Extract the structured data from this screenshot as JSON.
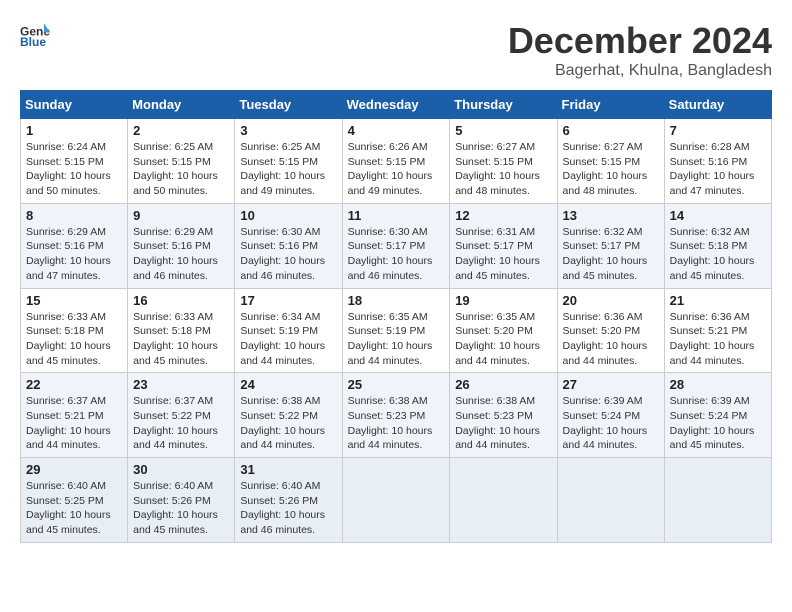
{
  "logo": {
    "line1": "General",
    "line2": "Blue"
  },
  "title": "December 2024",
  "location": "Bagerhat, Khulna, Bangladesh",
  "days_of_week": [
    "Sunday",
    "Monday",
    "Tuesday",
    "Wednesday",
    "Thursday",
    "Friday",
    "Saturday"
  ],
  "weeks": [
    [
      {
        "day": "1",
        "sunrise": "6:24 AM",
        "sunset": "5:15 PM",
        "daylight": "10 hours and 50 minutes."
      },
      {
        "day": "2",
        "sunrise": "6:25 AM",
        "sunset": "5:15 PM",
        "daylight": "10 hours and 50 minutes."
      },
      {
        "day": "3",
        "sunrise": "6:25 AM",
        "sunset": "5:15 PM",
        "daylight": "10 hours and 49 minutes."
      },
      {
        "day": "4",
        "sunrise": "6:26 AM",
        "sunset": "5:15 PM",
        "daylight": "10 hours and 49 minutes."
      },
      {
        "day": "5",
        "sunrise": "6:27 AM",
        "sunset": "5:15 PM",
        "daylight": "10 hours and 48 minutes."
      },
      {
        "day": "6",
        "sunrise": "6:27 AM",
        "sunset": "5:15 PM",
        "daylight": "10 hours and 48 minutes."
      },
      {
        "day": "7",
        "sunrise": "6:28 AM",
        "sunset": "5:16 PM",
        "daylight": "10 hours and 47 minutes."
      }
    ],
    [
      {
        "day": "8",
        "sunrise": "6:29 AM",
        "sunset": "5:16 PM",
        "daylight": "10 hours and 47 minutes."
      },
      {
        "day": "9",
        "sunrise": "6:29 AM",
        "sunset": "5:16 PM",
        "daylight": "10 hours and 46 minutes."
      },
      {
        "day": "10",
        "sunrise": "6:30 AM",
        "sunset": "5:16 PM",
        "daylight": "10 hours and 46 minutes."
      },
      {
        "day": "11",
        "sunrise": "6:30 AM",
        "sunset": "5:17 PM",
        "daylight": "10 hours and 46 minutes."
      },
      {
        "day": "12",
        "sunrise": "6:31 AM",
        "sunset": "5:17 PM",
        "daylight": "10 hours and 45 minutes."
      },
      {
        "day": "13",
        "sunrise": "6:32 AM",
        "sunset": "5:17 PM",
        "daylight": "10 hours and 45 minutes."
      },
      {
        "day": "14",
        "sunrise": "6:32 AM",
        "sunset": "5:18 PM",
        "daylight": "10 hours and 45 minutes."
      }
    ],
    [
      {
        "day": "15",
        "sunrise": "6:33 AM",
        "sunset": "5:18 PM",
        "daylight": "10 hours and 45 minutes."
      },
      {
        "day": "16",
        "sunrise": "6:33 AM",
        "sunset": "5:18 PM",
        "daylight": "10 hours and 45 minutes."
      },
      {
        "day": "17",
        "sunrise": "6:34 AM",
        "sunset": "5:19 PM",
        "daylight": "10 hours and 44 minutes."
      },
      {
        "day": "18",
        "sunrise": "6:35 AM",
        "sunset": "5:19 PM",
        "daylight": "10 hours and 44 minutes."
      },
      {
        "day": "19",
        "sunrise": "6:35 AM",
        "sunset": "5:20 PM",
        "daylight": "10 hours and 44 minutes."
      },
      {
        "day": "20",
        "sunrise": "6:36 AM",
        "sunset": "5:20 PM",
        "daylight": "10 hours and 44 minutes."
      },
      {
        "day": "21",
        "sunrise": "6:36 AM",
        "sunset": "5:21 PM",
        "daylight": "10 hours and 44 minutes."
      }
    ],
    [
      {
        "day": "22",
        "sunrise": "6:37 AM",
        "sunset": "5:21 PM",
        "daylight": "10 hours and 44 minutes."
      },
      {
        "day": "23",
        "sunrise": "6:37 AM",
        "sunset": "5:22 PM",
        "daylight": "10 hours and 44 minutes."
      },
      {
        "day": "24",
        "sunrise": "6:38 AM",
        "sunset": "5:22 PM",
        "daylight": "10 hours and 44 minutes."
      },
      {
        "day": "25",
        "sunrise": "6:38 AM",
        "sunset": "5:23 PM",
        "daylight": "10 hours and 44 minutes."
      },
      {
        "day": "26",
        "sunrise": "6:38 AM",
        "sunset": "5:23 PM",
        "daylight": "10 hours and 44 minutes."
      },
      {
        "day": "27",
        "sunrise": "6:39 AM",
        "sunset": "5:24 PM",
        "daylight": "10 hours and 44 minutes."
      },
      {
        "day": "28",
        "sunrise": "6:39 AM",
        "sunset": "5:24 PM",
        "daylight": "10 hours and 45 minutes."
      }
    ],
    [
      {
        "day": "29",
        "sunrise": "6:40 AM",
        "sunset": "5:25 PM",
        "daylight": "10 hours and 45 minutes."
      },
      {
        "day": "30",
        "sunrise": "6:40 AM",
        "sunset": "5:26 PM",
        "daylight": "10 hours and 45 minutes."
      },
      {
        "day": "31",
        "sunrise": "6:40 AM",
        "sunset": "5:26 PM",
        "daylight": "10 hours and 46 minutes."
      },
      {
        "day": "",
        "sunrise": "",
        "sunset": "",
        "daylight": ""
      },
      {
        "day": "",
        "sunrise": "",
        "sunset": "",
        "daylight": ""
      },
      {
        "day": "",
        "sunrise": "",
        "sunset": "",
        "daylight": ""
      },
      {
        "day": "",
        "sunrise": "",
        "sunset": "",
        "daylight": ""
      }
    ]
  ]
}
